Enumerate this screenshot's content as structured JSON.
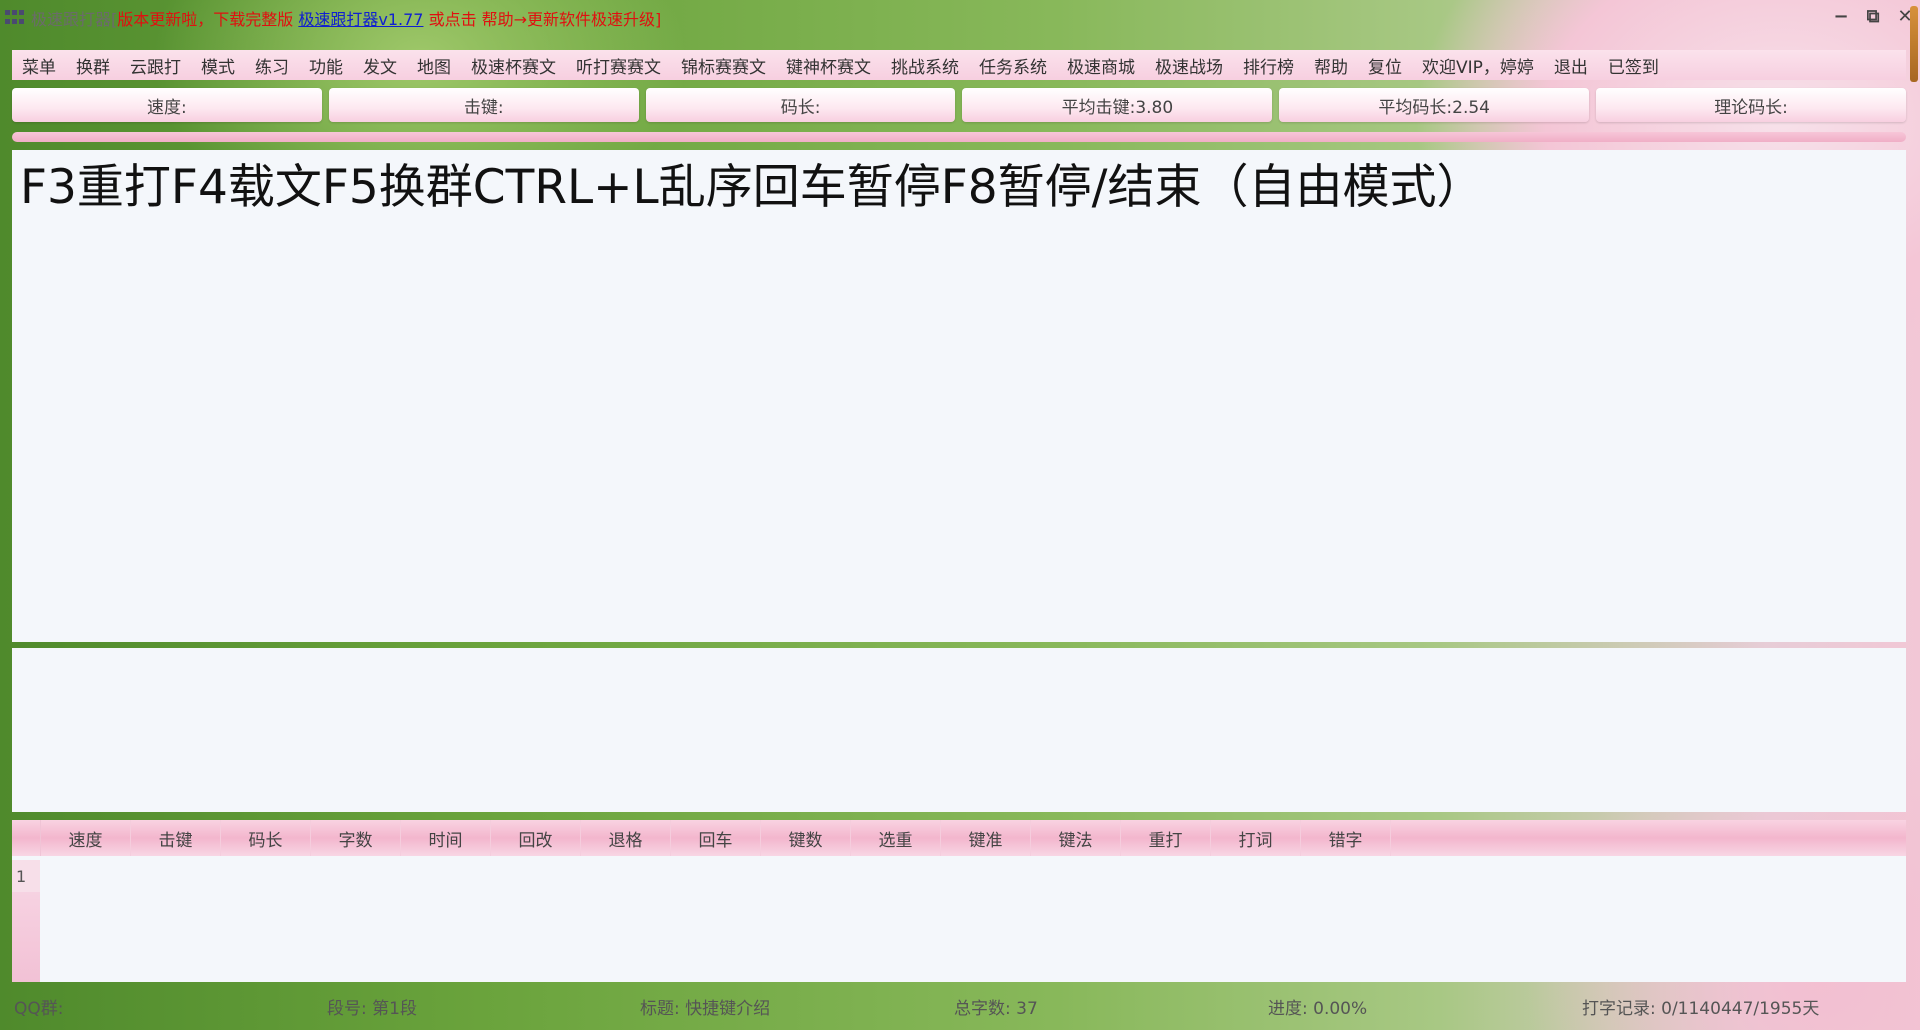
{
  "window": {
    "app_name": "极速跟打器[",
    "notice_red": "版本更新啦，下载完整版",
    "link": "极速跟打器v1.77",
    "notice_red2": "或点击 帮助→更新软件极速升级]",
    "controls": [
      "minimize",
      "restore",
      "close"
    ]
  },
  "menu": [
    "菜单",
    "换群",
    "云跟打",
    "模式",
    "练习",
    "功能",
    "发文",
    "地图",
    "极速杯赛文",
    "听打赛赛文",
    "锦标赛赛文",
    "键神杯赛文",
    "挑战系统",
    "任务系统",
    "极速商城",
    "极速战场",
    "排行榜",
    "帮助",
    "复位",
    "欢迎VIP，婷婷",
    "退出",
    "已签到"
  ],
  "stats": [
    "速度:",
    "击键:",
    "码长:",
    "平均击键:3.80",
    "平均码长:2.54",
    "理论码长:"
  ],
  "text_area": "F3重打F4载文F5换群CTRL+L乱序回车暂停F8暂停/结束（自由模式）",
  "table": {
    "headers": [
      "速度",
      "击键",
      "码长",
      "字数",
      "时间",
      "回改",
      "退格",
      "回车",
      "键数",
      "选重",
      "键准",
      "键法",
      "重打",
      "打词",
      "错字"
    ],
    "row_numbers": [
      "1"
    ]
  },
  "status": {
    "qq": "QQ群:",
    "segment": "段号: 第1段",
    "title": "标题: 快捷键介绍",
    "total": "总字数: 37",
    "progress": "进度: 0.00%",
    "record": "打字记录: 0/1140447/1955天"
  }
}
